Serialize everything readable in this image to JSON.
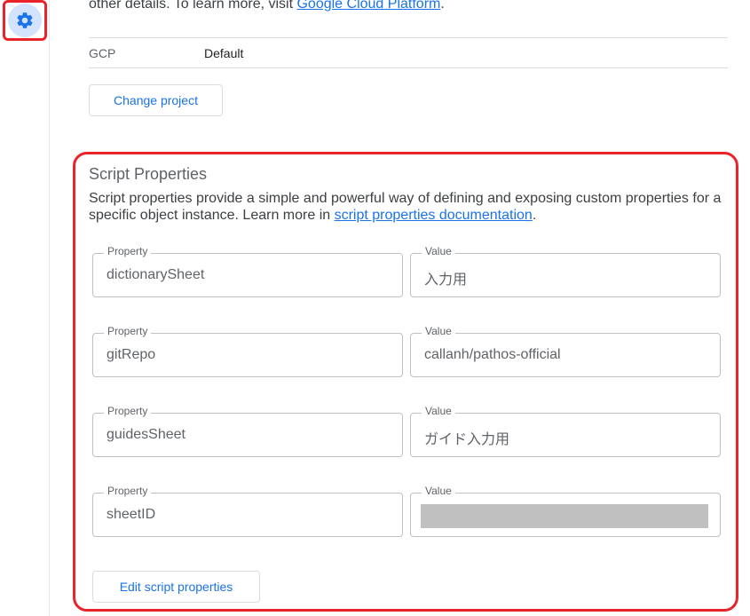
{
  "sidebar": {
    "settings_icon": "gear-icon"
  },
  "gcp": {
    "intro_line": "other details. To learn more, visit",
    "intro_link": "Google Cloud Platform",
    "intro_end": ".",
    "project_key": "GCP",
    "project_value": "Default",
    "change_button": "Change project"
  },
  "script_properties": {
    "title": "Script Properties",
    "description": "Script properties provide a simple and powerful way of defining and exposing custom properties for a specific object instance. Learn more in",
    "doc_link": "script properties documentation",
    "desc_end": ".",
    "property_label": "Property",
    "value_label": "Value",
    "rows": [
      {
        "property": "dictionarySheet",
        "value": "入力用"
      },
      {
        "property": "gitRepo",
        "value": "callanh/pathos-official"
      },
      {
        "property": "guidesSheet",
        "value": "ガイド入力用"
      },
      {
        "property": "sheetID",
        "value": ""
      }
    ],
    "edit_button": "Edit script properties"
  },
  "colors": {
    "accent": "#1a73e8",
    "highlight": "#e8242a",
    "icon_bg": "#d3e3fd"
  }
}
